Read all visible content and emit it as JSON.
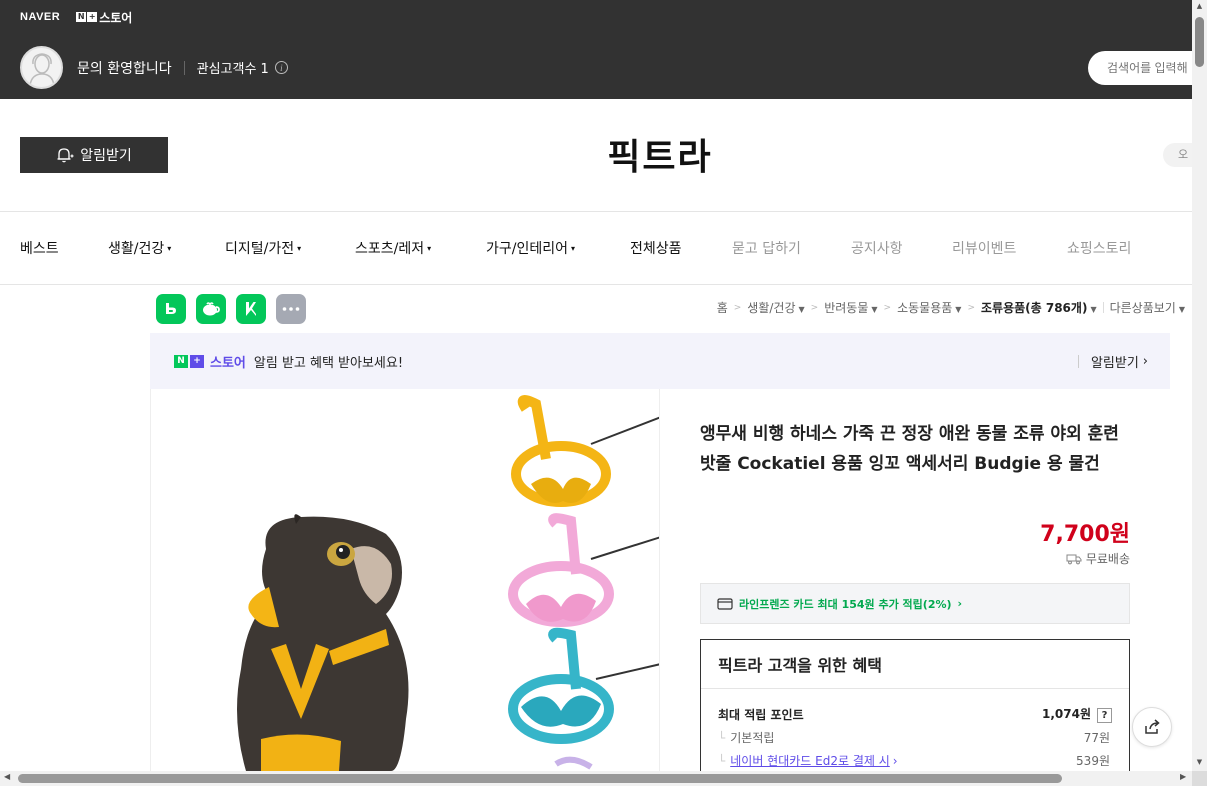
{
  "header": {
    "naver_logo": "NAVER",
    "store_logo_text": "스토어",
    "store_logo_badge": [
      "N",
      "+"
    ],
    "welcome": "문의 환영합니다",
    "fav_label": "관심고객수 1",
    "search_placeholder": "검색어를 입력해"
  },
  "store": {
    "alarm_button": "알림받기",
    "name": "픽트라",
    "right_pill": "오"
  },
  "nav": {
    "items": [
      {
        "label": "베스트",
        "dropdown": false,
        "muted": false
      },
      {
        "label": "생활/건강",
        "dropdown": true,
        "muted": false
      },
      {
        "label": "디지털/가전",
        "dropdown": true,
        "muted": false
      },
      {
        "label": "스포츠/레저",
        "dropdown": true,
        "muted": false
      },
      {
        "label": "가구/인테리어",
        "dropdown": true,
        "muted": false
      },
      {
        "label": "전체상품",
        "dropdown": false,
        "muted": false
      },
      {
        "label": "묻고 답하기",
        "dropdown": false,
        "muted": true
      },
      {
        "label": "공지사항",
        "dropdown": false,
        "muted": true
      },
      {
        "label": "리뷰이벤트",
        "dropdown": false,
        "muted": true
      },
      {
        "label": "쇼핑스토리",
        "dropdown": false,
        "muted": true
      }
    ]
  },
  "share_icons": [
    "band-icon",
    "kakaostory-icon",
    "blog-icon",
    "more-icon"
  ],
  "breadcrumb": {
    "home": "홈",
    "c1": "생활/건강",
    "c2": "반려동물",
    "c3": "소동물용품",
    "c4": "조류용품(총 786개)",
    "other": "다른상품보기"
  },
  "promo": {
    "logo_text": "스토어",
    "message": "알림 받고 혜택 받아보세요!",
    "link": "알림받기"
  },
  "product": {
    "title": "앵무새 비행 하네스 가죽 끈 정장 애완 동물 조류 야외 훈련 밧줄 Cockatiel 용품 잉꼬 액세서리 Budgie 용 물건",
    "price": "7,700원",
    "shipping": "무료배송",
    "card_promo": "라인프렌즈 카드 최대 154원 추가 적립(2%)"
  },
  "benefit": {
    "title": "픽트라 고객을 위한 혜택",
    "max_label": "최대 적립 포인트",
    "max_value": "1,074원",
    "basic_label": "기본적립",
    "basic_value": "77원",
    "card_label": "네이버 현대카드 Ed2로 결제 시",
    "card_value": "539원"
  },
  "colors": {
    "topbar": "#323232",
    "price": "#d0011b",
    "naver_green": "#03c75a",
    "store_purple": "#5f4ce8"
  }
}
